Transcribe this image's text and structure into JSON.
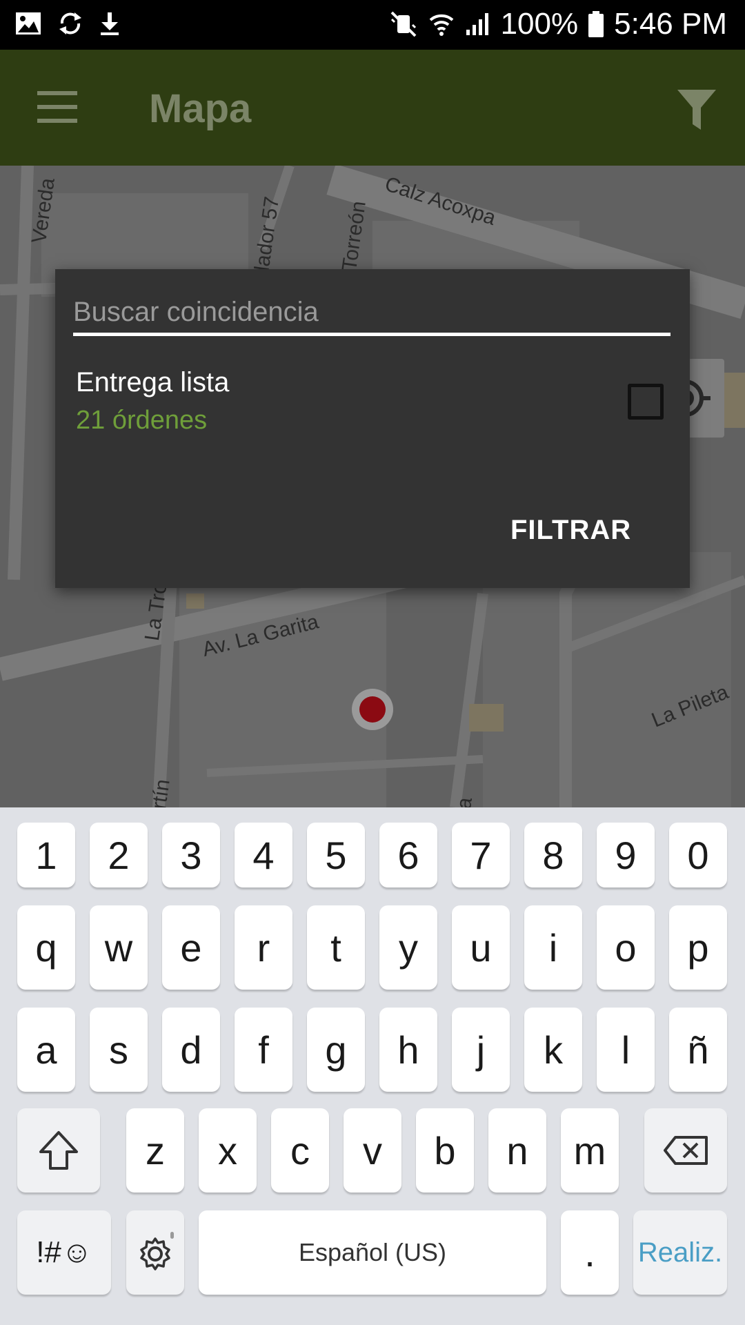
{
  "status_bar": {
    "battery": "100%",
    "time": "5:46 PM",
    "left_icons": [
      "image-icon",
      "sync-icon",
      "download-icon"
    ],
    "right_icons": [
      "mute-icon",
      "wifi-icon",
      "signal-icon",
      "battery-icon"
    ]
  },
  "app_bar": {
    "title": "Mapa",
    "menu_icon": "hamburger-icon",
    "filter_icon": "filter-funnel-icon"
  },
  "map": {
    "labels": [
      "Vereda",
      "dador 57",
      "Torreón",
      "Calz Acoxpa",
      "La Tro",
      "Av. La Garita",
      "La Pileta",
      "rtín",
      "a"
    ],
    "locate_icon": "gps-locate-icon"
  },
  "dialog": {
    "search_placeholder": "Buscar coincidencia",
    "item_title": "Entrega lista",
    "item_count": "21 órdenes",
    "item_checked": false,
    "filter_button": "FILTRAR"
  },
  "keyboard": {
    "row_numbers": [
      "1",
      "2",
      "3",
      "4",
      "5",
      "6",
      "7",
      "8",
      "9",
      "0"
    ],
    "row_1": [
      "q",
      "w",
      "e",
      "r",
      "t",
      "y",
      "u",
      "i",
      "o",
      "p"
    ],
    "row_2": [
      "a",
      "s",
      "d",
      "f",
      "g",
      "h",
      "j",
      "k",
      "l",
      "ñ"
    ],
    "row_3": [
      "z",
      "x",
      "c",
      "v",
      "b",
      "n",
      "m"
    ],
    "symbols_key": "!#☺",
    "space_label": "Español (US)",
    "period": ".",
    "done_label": "Realiz."
  },
  "colors": {
    "app_bar": "#2e3d12",
    "accent_green": "#6f9f3a",
    "dialog_bg": "#333333",
    "done_blue": "#4a9ec5",
    "marker_red": "#8b0a12"
  }
}
